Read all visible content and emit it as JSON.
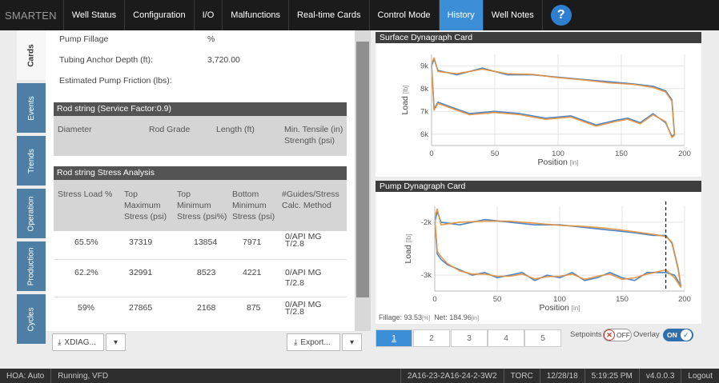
{
  "brand": "SMARTEN",
  "nav": {
    "tabs": [
      "Well Status",
      "Configuration",
      "I/O",
      "Malfunctions",
      "Real-time Cards",
      "Control Mode",
      "History",
      "Well Notes"
    ],
    "active": "History",
    "help": "?"
  },
  "sidetabs": [
    "Cards",
    "Events",
    "Trends",
    "Operation",
    "Production",
    "Cycles"
  ],
  "fields": {
    "pump_fillage_label": "Pump Fillage",
    "pump_fillage_value": "%",
    "tubing_anchor_label": "Tubing Anchor Depth (ft):",
    "tubing_anchor_value": "3,720.00",
    "pump_friction_label": "Estimated Pump Friction (lbs):"
  },
  "rod_string": {
    "title": "Rod string (Service Factor:0.9)",
    "headers": [
      "Diameter",
      "Rod Grade",
      "Length (ft)",
      "Min. Tensile (in)\nStrength (psi)"
    ]
  },
  "stress": {
    "title": "Rod string Stress Analysis",
    "headers": [
      "Stress Load %",
      "Top\nMaximum\nStress (psi)",
      "Top\nMinimum\nStress (psi%)",
      "Bottom\nMinimum\nStress (psi)",
      "#Guides/Stress\nCalc. Method"
    ],
    "rows": [
      [
        "65.5%",
        "37319",
        "13854",
        "7971",
        "0/API MG\nT/2.8"
      ],
      [
        "62.2%",
        "32991",
        "8523",
        "4221",
        "0/API MG\nT/2.8"
      ],
      [
        "59%",
        "27865",
        "2168",
        "875",
        "0/API MG\nT/2.8"
      ]
    ]
  },
  "buttons": {
    "xdiag": "XDIAG...",
    "export": "Export...",
    "dropdown": "▾"
  },
  "surface_card": {
    "title": "Surface Dynagraph Card",
    "ylabel": "Load",
    "yunit": "[lb]",
    "xlabel": "Position",
    "xunit": "[in]",
    "yticks": [
      "9k",
      "8k",
      "7k",
      "6k"
    ],
    "xticks": [
      "0",
      "50",
      "100",
      "150",
      "200"
    ]
  },
  "pump_card": {
    "title": "Pump Dynagraph Card",
    "ylabel": "Load",
    "yunit": "[lb]",
    "xlabel": "Position",
    "xunit": "[in]",
    "yticks": [
      "-2k",
      "-3k"
    ],
    "xticks": [
      "0",
      "50",
      "100",
      "150",
      "200"
    ],
    "fillage_label": "Fillage: 93.53",
    "fillage_unit": "[%]",
    "net_label": "Net: 184.96",
    "net_unit": "[in]"
  },
  "chart_data": [
    {
      "type": "line",
      "title": "Surface Dynagraph Card",
      "xlabel": "Position [in]",
      "ylabel": "Load [lb]",
      "xlim": [
        0,
        200
      ],
      "ylim": [
        5500,
        9500
      ],
      "series": [
        {
          "color": "#3a78c2",
          "x": [
            0,
            2,
            5,
            20,
            40,
            60,
            80,
            100,
            120,
            140,
            160,
            175,
            185,
            190,
            192,
            190,
            185,
            175,
            165,
            155,
            145,
            130,
            110,
            90,
            70,
            50,
            30,
            15,
            5,
            2,
            0
          ],
          "y": [
            9000,
            9300,
            8800,
            8600,
            8900,
            8600,
            8600,
            8500,
            8400,
            8300,
            8200,
            8100,
            7900,
            7500,
            6000,
            5900,
            6500,
            6900,
            6500,
            6700,
            6600,
            6400,
            6800,
            6700,
            6900,
            7000,
            6900,
            7200,
            7400,
            7100,
            9000
          ]
        },
        {
          "color": "#e6913a",
          "x": [
            0,
            2,
            5,
            20,
            40,
            60,
            80,
            100,
            120,
            140,
            160,
            175,
            185,
            190,
            192,
            190,
            185,
            175,
            165,
            155,
            145,
            130,
            110,
            90,
            70,
            50,
            30,
            15,
            5,
            2,
            0
          ],
          "y": [
            9100,
            9350,
            8750,
            8650,
            8850,
            8650,
            8620,
            8480,
            8380,
            8250,
            8180,
            8050,
            7850,
            7450,
            5950,
            5850,
            6550,
            6850,
            6450,
            6650,
            6550,
            6350,
            6750,
            6650,
            6850,
            6950,
            6850,
            7150,
            7350,
            7050,
            9100
          ]
        }
      ]
    },
    {
      "type": "line",
      "title": "Pump Dynagraph Card",
      "xlabel": "Position [in]",
      "ylabel": "Load [lb]",
      "xlim": [
        0,
        200
      ],
      "ylim": [
        -3300,
        -1700
      ],
      "series": [
        {
          "color": "#3a78c2",
          "x": [
            0,
            2,
            5,
            20,
            40,
            60,
            80,
            100,
            120,
            140,
            160,
            175,
            185,
            190,
            195,
            197,
            192,
            185,
            170,
            160,
            150,
            140,
            130,
            120,
            110,
            100,
            90,
            80,
            70,
            60,
            50,
            40,
            30,
            20,
            10,
            5,
            2,
            0
          ],
          "y": [
            -2000,
            -1800,
            -2000,
            -2050,
            -1950,
            -2000,
            -2050,
            -2050,
            -2100,
            -2150,
            -2200,
            -2250,
            -2250,
            -2400,
            -2900,
            -3200,
            -3000,
            -2950,
            -2950,
            -3100,
            -3050,
            -2950,
            -3050,
            -3100,
            -2950,
            -3050,
            -3000,
            -3100,
            -2950,
            -3000,
            -3050,
            -2950,
            -3000,
            -2900,
            -2800,
            -2700,
            -2600,
            -2000
          ]
        },
        {
          "color": "#e6913a",
          "x": [
            0,
            2,
            5,
            20,
            40,
            60,
            80,
            100,
            120,
            140,
            160,
            175,
            185,
            190,
            195,
            197,
            192,
            185,
            170,
            160,
            150,
            140,
            130,
            120,
            110,
            100,
            90,
            80,
            70,
            60,
            50,
            40,
            30,
            20,
            10,
            5,
            2,
            0
          ],
          "y": [
            -1900,
            -1750,
            -2050,
            -2000,
            -1980,
            -1980,
            -2020,
            -2060,
            -2080,
            -2120,
            -2180,
            -2230,
            -2270,
            -2380,
            -2880,
            -3230,
            -3050,
            -2900,
            -2980,
            -3050,
            -3080,
            -2980,
            -3020,
            -3080,
            -2980,
            -3020,
            -3030,
            -3070,
            -2980,
            -3020,
            -3020,
            -2980,
            -2980,
            -2920,
            -2780,
            -2650,
            -2550,
            -1900
          ]
        }
      ],
      "marker_x": 184.96
    }
  ],
  "pagination": {
    "pages": [
      "1",
      "2",
      "3",
      "4",
      "5"
    ],
    "active": "1"
  },
  "setpoints": {
    "label": "Setpoints",
    "state": "OFF",
    "overlay_label": "Overlay",
    "overlay_state": "ON"
  },
  "footer": {
    "hoa": "HOA: Auto",
    "status": "Running, VFD",
    "well": "2A16-23-2A16-24-2-3W2",
    "torc": "TORC",
    "date": "12/28/18",
    "time": "5:19:25 PM",
    "version": "v4.0.0.3",
    "logout": "Logout"
  }
}
